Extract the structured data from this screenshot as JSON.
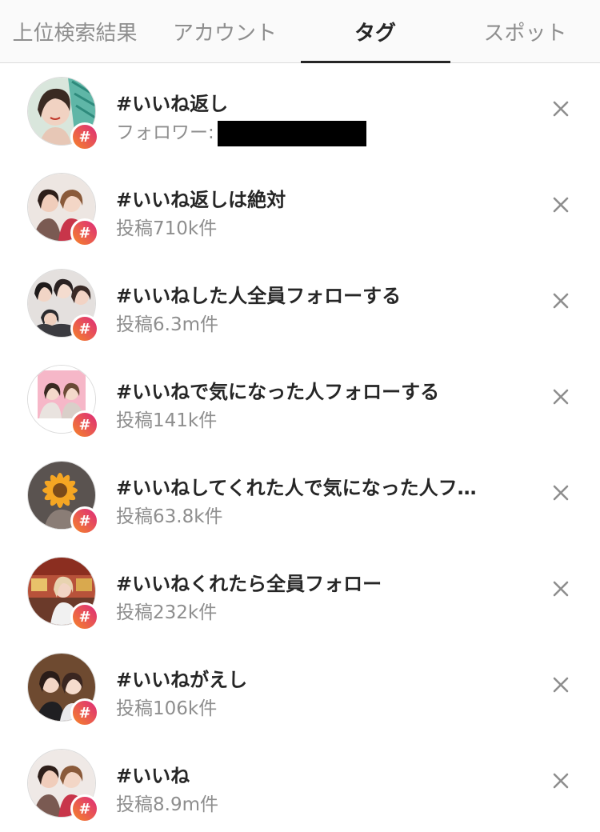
{
  "tabs": [
    {
      "label": "上位検索結果"
    },
    {
      "label": "アカウント"
    },
    {
      "label": "タグ"
    },
    {
      "label": "スポット"
    }
  ],
  "active_tab": "タグ",
  "hash_symbol": "#",
  "colors": {
    "badge_gradient_start": "#f58529",
    "badge_gradient_end": "#dd2a7b",
    "text_primary": "#262626",
    "text_secondary": "#8e8e8e"
  },
  "results": [
    {
      "tag": "#いいね返し",
      "sub_label": "フォロワー:",
      "sub": "",
      "redacted": true
    },
    {
      "tag": "#いいね返しは絶対",
      "sub": "投稿710k件"
    },
    {
      "tag": "#いいねした人全員フォローする",
      "sub": "投稿6.3m件"
    },
    {
      "tag": "#いいねで気になった人フォローする",
      "sub": "投稿141k件"
    },
    {
      "tag": "#いいねしてくれた人で気になった人フ…",
      "sub": "投稿63.8k件"
    },
    {
      "tag": "#いいねくれたら全員フォロー",
      "sub": "投稿232k件"
    },
    {
      "tag": "#いいねがえし",
      "sub": "投稿106k件"
    },
    {
      "tag": "#いいね",
      "sub": "投稿8.9m件"
    }
  ]
}
